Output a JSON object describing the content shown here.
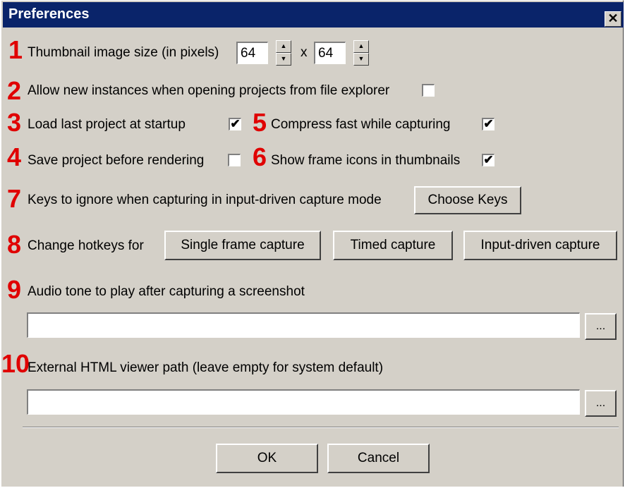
{
  "window": {
    "title": "Preferences",
    "close_glyph": "✕"
  },
  "markers": [
    "1",
    "2",
    "3",
    "4",
    "5",
    "6",
    "7",
    "8",
    "9",
    "10"
  ],
  "thumbnail": {
    "label": "Thumbnail image size (in pixels)",
    "width": "64",
    "x": "x",
    "height": "64"
  },
  "allow_instances": {
    "label": "Allow new instances when opening projects from file explorer",
    "checked": false
  },
  "load_last": {
    "label": "Load last project at startup",
    "checked": true
  },
  "save_before": {
    "label": "Save project before rendering",
    "checked": false
  },
  "compress_fast": {
    "label": "Compress fast while capturing",
    "checked": true
  },
  "show_icons": {
    "label": "Show frame icons in thumbnails",
    "checked": true
  },
  "keys_ignore": {
    "label": "Keys to ignore when capturing in input-driven capture mode",
    "button": "Choose Keys"
  },
  "hotkeys": {
    "label": "Change hotkeys for",
    "single": "Single frame capture",
    "timed": "Timed capture",
    "input": "Input-driven capture"
  },
  "audio": {
    "label": "Audio tone to play after capturing a screenshot",
    "value": "",
    "browse": "..."
  },
  "viewer": {
    "label": "External HTML viewer path (leave empty for system default)",
    "value": "",
    "browse": "..."
  },
  "footer": {
    "ok": "OK",
    "cancel": "Cancel"
  },
  "check_glyph": "✔",
  "colors": {
    "titlebar": "#0a246a",
    "dialog": "#d4d0c8",
    "marker": "#e00000"
  }
}
